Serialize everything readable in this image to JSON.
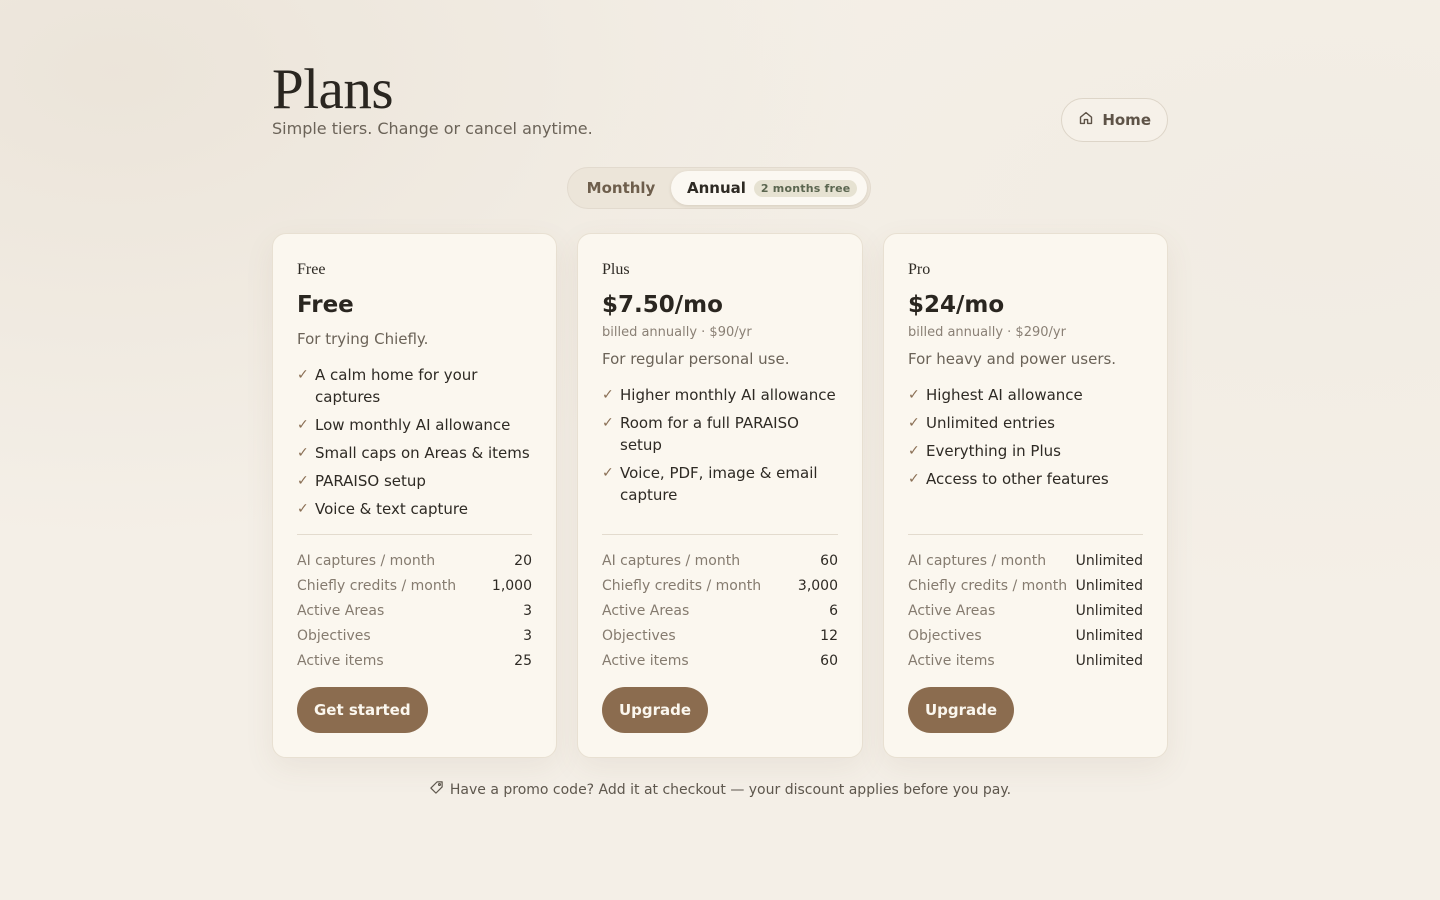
{
  "header": {
    "title": "Plans",
    "subtitle": "Simple tiers. Change or cancel anytime.",
    "home_label": "Home"
  },
  "billing_toggle": {
    "monthly_label": "Monthly",
    "annual_label": "Annual",
    "annual_badge": "2 months free",
    "selected": "Annual"
  },
  "plans": [
    {
      "name": "Free",
      "price": "Free",
      "billed": "",
      "description": "For trying Chiefly.",
      "features": [
        "A calm home for your captures",
        "Low monthly AI allowance",
        "Small caps on Areas & items",
        "PARAISO setup",
        "Voice & text capture"
      ],
      "stats": [
        {
          "label": "AI captures / month",
          "value": "20"
        },
        {
          "label": "Chiefly credits / month",
          "value": "1,000"
        },
        {
          "label": "Active Areas",
          "value": "3"
        },
        {
          "label": "Objectives",
          "value": "3"
        },
        {
          "label": "Active items",
          "value": "25"
        }
      ],
      "cta": "Get started"
    },
    {
      "name": "Plus",
      "price": "$7.50/mo",
      "billed": "billed annually · $90/yr",
      "description": "For regular personal use.",
      "features": [
        "Higher monthly AI allowance",
        "Room for a full PARAISO setup",
        "Voice, PDF, image & email capture"
      ],
      "stats": [
        {
          "label": "AI captures / month",
          "value": "60"
        },
        {
          "label": "Chiefly credits / month",
          "value": "3,000"
        },
        {
          "label": "Active Areas",
          "value": "6"
        },
        {
          "label": "Objectives",
          "value": "12"
        },
        {
          "label": "Active items",
          "value": "60"
        }
      ],
      "cta": "Upgrade"
    },
    {
      "name": "Pro",
      "price": "$24/mo",
      "billed": "billed annually · $290/yr",
      "description": "For heavy and power users.",
      "features": [
        "Highest AI allowance",
        "Unlimited entries",
        "Everything in Plus",
        "Access to other features"
      ],
      "stats": [
        {
          "label": "AI captures / month",
          "value": "Unlimited"
        },
        {
          "label": "Chiefly credits / month",
          "value": "Unlimited"
        },
        {
          "label": "Active Areas",
          "value": "Unlimited"
        },
        {
          "label": "Objectives",
          "value": "Unlimited"
        },
        {
          "label": "Active items",
          "value": "Unlimited"
        }
      ],
      "cta": "Upgrade"
    }
  ],
  "promo": {
    "icon": "tag-icon",
    "text": "Have a promo code? Add it at checkout — your discount applies before you pay."
  },
  "colors": {
    "background": "#f4efe7",
    "card": "#fbf7ef",
    "accent": "#8b6c4f",
    "badge_bg": "#e6e2d2",
    "badge_text": "#5b6650"
  }
}
